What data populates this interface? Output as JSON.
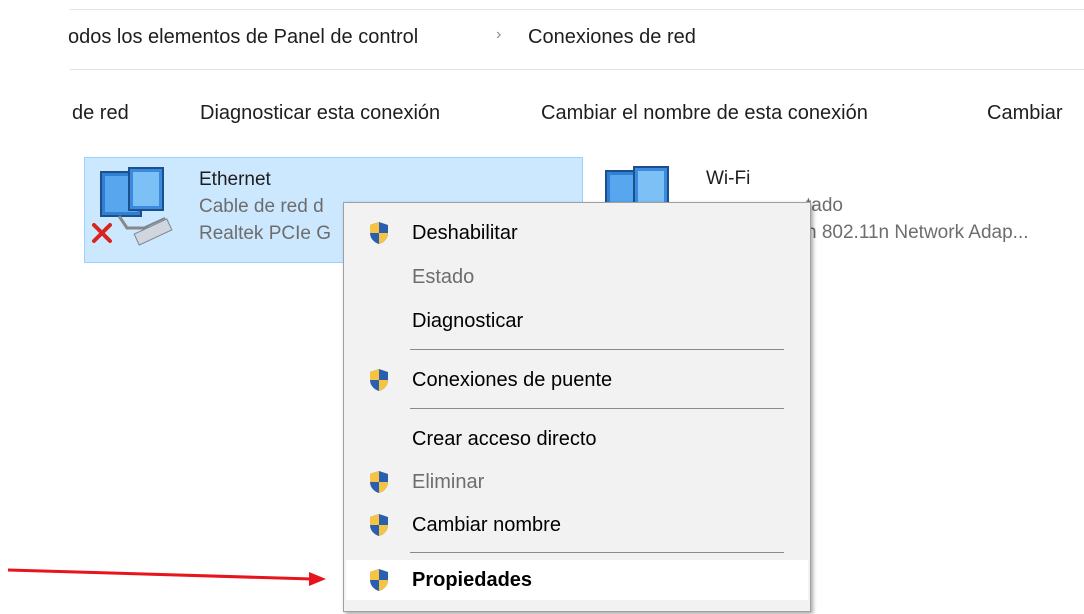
{
  "breadcrumb": {
    "parent": "odos los elementos de Panel de control",
    "separator": "›",
    "current": "Conexiones de red"
  },
  "toolbar": {
    "items": [
      "de red",
      "Diagnosticar esta conexión",
      "Cambiar el nombre de esta conexión",
      "Cambiar"
    ]
  },
  "connections": [
    {
      "name": "Ethernet",
      "line1": "Cable de red d",
      "line2": "Realtek PCIe G",
      "status_icon": "red-x-disconnected-icon",
      "selected": true
    },
    {
      "name": "Wi-Fi",
      "line1": "tado",
      "line2": "n 802.11n Network Adap...",
      "selected": false
    }
  ],
  "context_menu": {
    "items": [
      {
        "label": "Deshabilitar",
        "shield": true,
        "disabled": false
      },
      {
        "label": "Estado",
        "shield": false,
        "disabled": true
      },
      {
        "label": "Diagnosticar",
        "shield": false,
        "disabled": false
      },
      {
        "label": "Conexiones de puente",
        "shield": true,
        "disabled": false
      },
      {
        "label": "Crear acceso directo",
        "shield": false,
        "disabled": false
      },
      {
        "label": "Eliminar",
        "shield": true,
        "disabled": true
      },
      {
        "label": "Cambiar nombre",
        "shield": true,
        "disabled": false
      },
      {
        "label": "Propiedades",
        "shield": true,
        "disabled": false,
        "bold": true,
        "highlighted": true
      }
    ]
  },
  "colors": {
    "selection_bg": "#cce8ff",
    "selection_border": "#99d1ff",
    "menu_bg": "#f2f2f2",
    "arrow": "#e8141b",
    "shield_blue": "#2a5fb0",
    "shield_yellow": "#f6c342"
  }
}
